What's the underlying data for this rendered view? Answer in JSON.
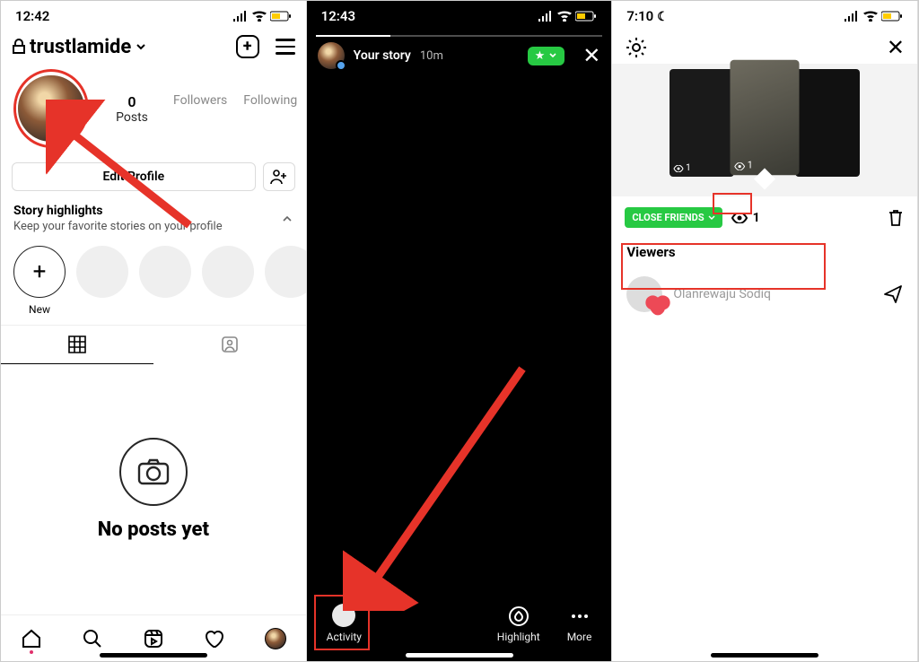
{
  "screen1": {
    "status_time": "12:42",
    "username": "trustlamide",
    "stats": {
      "posts_num": "0",
      "posts_lbl": "Posts",
      "followers_lbl": "Followers",
      "following_lbl": "Following"
    },
    "edit_profile": "Edit Profile",
    "highlights_title": "Story highlights",
    "highlights_sub": "Keep your favorite stories on your profile",
    "highlight_new": "New",
    "no_posts": "No posts yet"
  },
  "screen2": {
    "status_time": "12:43",
    "story_label": "Your story",
    "story_time": "10m",
    "activity_label": "Activity",
    "highlight_label": "Highlight",
    "more_label": "More"
  },
  "screen3": {
    "status_time": "7:10",
    "thumb_views": "1",
    "close_friends": "CLOSE FRIENDS",
    "view_count": "1",
    "viewers_header": "Viewers",
    "viewer_name": "Olanrewaju Sodiq"
  }
}
